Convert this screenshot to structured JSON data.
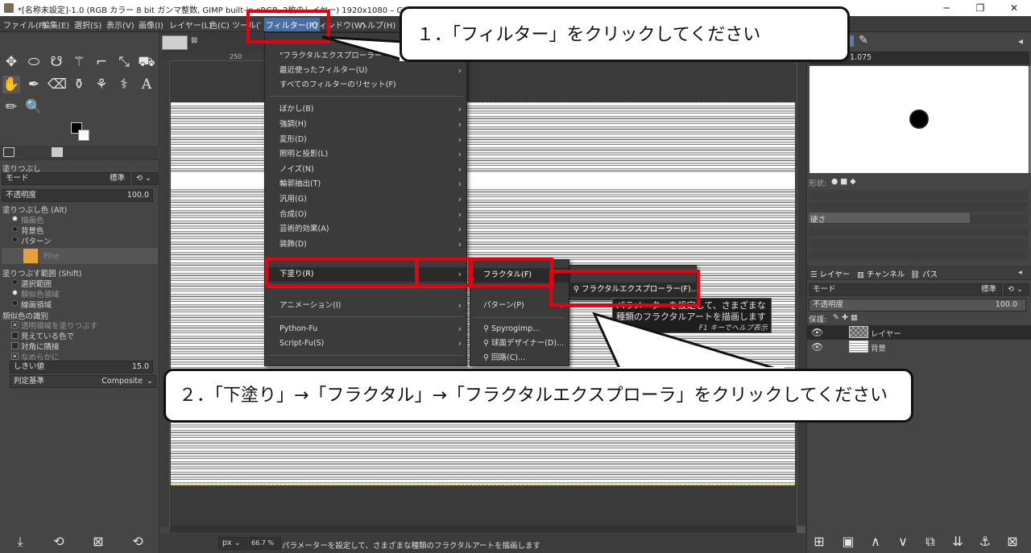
{
  "titlebar": {
    "title": "*[名称未設定]-1.0 (RGB カラー 8 bit ガンマ整数, GIMP built-in sRGB, 2枚のレイヤー) 1920x1080 – GIMP",
    "minimize": "─",
    "maximize": "❐",
    "close": "✕"
  },
  "menubar": {
    "items": [
      "ファイル(F)",
      "編集(E)",
      "選択(S)",
      "表示(V)",
      "画像(I)",
      "レイヤー(L)",
      "色(C)",
      "ツール(T)",
      "フィルター(R)",
      "ウィンドウ(W)",
      "ヘルプ(H)"
    ]
  },
  "toolbox": {
    "tools": [
      "✥",
      "⬭",
      "☋",
      "⚚",
      "⌐",
      "⤡",
      "⛟",
      "✋",
      "✒",
      "⌫",
      "⚱",
      "⚘",
      "⚕",
      "A",
      "✏",
      "🔍"
    ],
    "tool_icons": [
      "move-icon",
      "ellipse-select-icon",
      "free-select-icon",
      "fuzzy-select-icon",
      "crop-icon",
      "transform-icon",
      "warp-icon",
      "bucket-fill-icon",
      "paintbrush-icon",
      "eraser-icon",
      "clone-icon",
      "smudge-icon",
      "path-icon",
      "text-icon",
      "color-picker-icon",
      "zoom-icon"
    ]
  },
  "tool_options": {
    "title": "塗りつぶし",
    "mode_label": "モード",
    "mode_value": "標準",
    "opacity_label": "不透明度",
    "opacity_value": "100.0",
    "fill_type_label": "塗りつぶし色 (Alt)",
    "fill_options": [
      "描画色",
      "背景色",
      "パターン"
    ],
    "pattern_name": "Pine",
    "fill_area_label": "塗りつぶす範囲 (Shift)",
    "area_options": [
      "選択範囲",
      "類似色領域",
      "線画領域"
    ],
    "similar_label": "類似色の識別",
    "checks": [
      "透明領域を塗りつぶす",
      "見えている色で",
      "対角に隣接",
      "なめらかに"
    ],
    "threshold_label": "しきい値",
    "threshold_value": "15.0",
    "criterion_label": "判定基準",
    "criterion_value": "Composite"
  },
  "filter_menu": {
    "items": [
      {
        "label": "\"フラクタルエクスプローラー\" の再表示(E)",
        "arrow": false
      },
      {
        "label": "最近使ったフィルター(U)",
        "arrow": true
      },
      {
        "label": "すべてのフィルターのリセット(F)",
        "arrow": false
      },
      {
        "label": "ぼかし(B)",
        "arrow": true
      },
      {
        "label": "強調(H)",
        "arrow": true
      },
      {
        "label": "変形(D)",
        "arrow": true
      },
      {
        "label": "照明と投影(L)",
        "arrow": true
      },
      {
        "label": "ノイズ(N)",
        "arrow": true
      },
      {
        "label": "輪郭抽出(T)",
        "arrow": true
      },
      {
        "label": "汎用(G)",
        "arrow": true
      },
      {
        "label": "合成(O)",
        "arrow": true
      },
      {
        "label": "芸術的効果(A)",
        "arrow": true
      },
      {
        "label": "装飾(D)",
        "arrow": true
      },
      {
        "label": "下塗り(R)",
        "arrow": true
      },
      {
        "label": "アニメーション(I)",
        "arrow": true
      },
      {
        "label": "Python-Fu",
        "arrow": true
      },
      {
        "label": "Script-Fu(S)",
        "arrow": true
      }
    ]
  },
  "render_submenu": {
    "items": [
      "フラクタル(F)",
      "パターン(P)",
      "Spyrogimp...",
      "球面デザイナー(D)...",
      "回路(C)..."
    ]
  },
  "fractal_submenu": {
    "items": [
      "フラクタルエクスプローラー(F)..."
    ]
  },
  "tooltip": {
    "line1": "パラメーターを設定して、さまざまな",
    "line2": "種類のフラクタルアートを描画します",
    "help": "F1 キーでヘルプ表示"
  },
  "ruler": {
    "mark": "250"
  },
  "statusbar": {
    "unit": "px",
    "zoom": "66.7 %",
    "message": "パラメーターを設定して、さまざまな種類のフラクタルアートを描画します"
  },
  "brushes": {
    "size_value": "1.075",
    "shape_label": "形状:",
    "hardness_label": "硬さ"
  },
  "layers": {
    "tabs": [
      "レイヤー",
      "チャンネル",
      "パス"
    ],
    "mode_label": "モード",
    "mode_value": "標準",
    "opacity_label": "不透明度",
    "opacity_value": "100.0",
    "lock_label": "保護:",
    "rows": [
      {
        "name": "レイヤー"
      },
      {
        "name": "背景"
      }
    ]
  },
  "callouts": {
    "step1": "１．「フィルター」をクリックしてください",
    "step2": "２．「下塗り」→「フラクタル」→「フラクタルエクスプローラ」をクリックしてください"
  },
  "colors": {
    "highlight": "#e60012",
    "menu_bg": "#3b3b3b",
    "panel_bg": "#454545"
  }
}
